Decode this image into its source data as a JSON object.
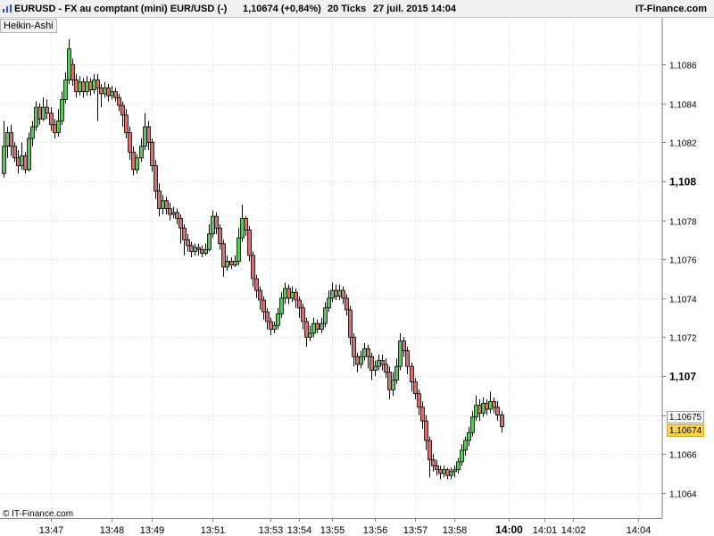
{
  "header": {
    "symbol": "EURUSD - FX au comptant (mini) EUR/USD (-)",
    "quote": "1,10674 (+0,84%)",
    "ticks": "20 Ticks",
    "date": "27 juil. 2015 14:04",
    "brand": "IT-Finance.com",
    "logo_icon": "chart-logo-icon"
  },
  "indicator_label": "Heikin-Ashi",
  "copyright": "© IT-Finance.com",
  "price_labels": {
    "cursor": "1,10675",
    "last": "1,10674"
  },
  "colors": {
    "up": "#5cc85c",
    "down": "#d97070",
    "last_price_bg": "#ffd24a",
    "grid": "#d9d9d9"
  },
  "chart_data": {
    "type": "candlestick",
    "style": "Heikin-Ashi",
    "ylim": [
      1.10628,
      1.10883
    ],
    "y_ticks": [
      {
        "v": 1.1064,
        "label": "1,1064",
        "bold": false
      },
      {
        "v": 1.1066,
        "label": "1,1066",
        "bold": false
      },
      {
        "v": 1.1068,
        "label": "1,1068",
        "bold": false
      },
      {
        "v": 1.107,
        "label": "1,107",
        "bold": true
      },
      {
        "v": 1.1072,
        "label": "1,1072",
        "bold": false
      },
      {
        "v": 1.1074,
        "label": "1,1074",
        "bold": false
      },
      {
        "v": 1.1076,
        "label": "1,1076",
        "bold": false
      },
      {
        "v": 1.1078,
        "label": "1,1078",
        "bold": false
      },
      {
        "v": 1.108,
        "label": "1,108",
        "bold": true
      },
      {
        "v": 1.1082,
        "label": "1,1082",
        "bold": false
      },
      {
        "v": 1.1084,
        "label": "1,1084",
        "bold": false
      },
      {
        "v": 1.1086,
        "label": "1,1086",
        "bold": false
      }
    ],
    "x_ticks": [
      {
        "i": 13,
        "label": "13:47",
        "bold": false
      },
      {
        "i": 30,
        "label": "13:48",
        "bold": false
      },
      {
        "i": 41,
        "label": "13:49",
        "bold": false
      },
      {
        "i": 58,
        "label": "13:51",
        "bold": false
      },
      {
        "i": 74,
        "label": "13:53",
        "bold": false
      },
      {
        "i": 82,
        "label": "13:54",
        "bold": false
      },
      {
        "i": 91,
        "label": "13:55",
        "bold": false
      },
      {
        "i": 103,
        "label": "13:56",
        "bold": false
      },
      {
        "i": 114,
        "label": "13:57",
        "bold": false
      },
      {
        "i": 125,
        "label": "13:58",
        "bold": false
      },
      {
        "i": 140,
        "label": "14:00",
        "bold": true
      },
      {
        "i": 150,
        "label": "14:01",
        "bold": false
      },
      {
        "i": 158,
        "label": "14:02",
        "bold": false
      },
      {
        "i": 176,
        "label": "14:04",
        "bold": false
      }
    ],
    "candles": [
      [
        1.10804,
        1.10818,
        1.10831,
        1.10802
      ],
      [
        1.10818,
        1.10825,
        1.10828,
        1.10812
      ],
      [
        1.10825,
        1.10818,
        1.10829,
        1.10813
      ],
      [
        1.10818,
        1.10812,
        1.1082,
        1.1081
      ],
      [
        1.10812,
        1.10808,
        1.10816,
        1.10804
      ],
      [
        1.10808,
        1.10813,
        1.1082,
        1.10806
      ],
      [
        1.10813,
        1.10806,
        1.10815,
        1.10804
      ],
      [
        1.10806,
        1.10822,
        1.10825,
        1.10805
      ],
      [
        1.10822,
        1.10828,
        1.10831,
        1.10818
      ],
      [
        1.10828,
        1.10838,
        1.10841,
        1.10826
      ],
      [
        1.10838,
        1.10832,
        1.1084,
        1.10829
      ],
      [
        1.10832,
        1.10838,
        1.10843,
        1.10831
      ],
      [
        1.10838,
        1.10835,
        1.10842,
        1.10832
      ],
      [
        1.10835,
        1.10829,
        1.10838,
        1.10826
      ],
      [
        1.10829,
        1.10825,
        1.10832,
        1.10822
      ],
      [
        1.10825,
        1.10831,
        1.10837,
        1.10823
      ],
      [
        1.10831,
        1.10842,
        1.10846,
        1.10829
      ],
      [
        1.10842,
        1.10852,
        1.10856,
        1.1084
      ],
      [
        1.10852,
        1.10868,
        1.10873,
        1.1085
      ],
      [
        1.1086,
        1.10852,
        1.10863,
        1.10849
      ],
      [
        1.10852,
        1.10846,
        1.10855,
        1.10843
      ],
      [
        1.10846,
        1.10851,
        1.10854,
        1.10844
      ],
      [
        1.10851,
        1.10846,
        1.10853,
        1.10843
      ],
      [
        1.10846,
        1.10851,
        1.10854,
        1.10844
      ],
      [
        1.10851,
        1.10847,
        1.10853,
        1.10844
      ],
      [
        1.10847,
        1.10852,
        1.10855,
        1.10845
      ],
      [
        1.10852,
        1.10848,
        1.10855,
        1.10831
      ],
      [
        1.10848,
        1.10845,
        1.1085,
        1.10838
      ],
      [
        1.10845,
        1.10848,
        1.10851,
        1.10843
      ],
      [
        1.10848,
        1.10844,
        1.1085,
        1.10841
      ],
      [
        1.10844,
        1.10846,
        1.10849,
        1.10842
      ],
      [
        1.10846,
        1.10843,
        1.10848,
        1.10841
      ],
      [
        1.10843,
        1.10839,
        1.10845,
        1.10836
      ],
      [
        1.10839,
        1.10834,
        1.10841,
        1.10828
      ],
      [
        1.10834,
        1.10825,
        1.10837,
        1.10822
      ],
      [
        1.10825,
        1.10815,
        1.10828,
        1.10811
      ],
      [
        1.10815,
        1.10806,
        1.10818,
        1.10803
      ],
      [
        1.10806,
        1.10812,
        1.10814,
        1.10804
      ],
      [
        1.10812,
        1.10818,
        1.10822,
        1.1081
      ],
      [
        1.10818,
        1.10828,
        1.10835,
        1.10816
      ],
      [
        1.10828,
        1.1082,
        1.10831,
        1.10816
      ],
      [
        1.1082,
        1.10808,
        1.10822,
        1.10805
      ],
      [
        1.10808,
        1.10795,
        1.10811,
        1.10791
      ],
      [
        1.10795,
        1.10786,
        1.10799,
        1.10782
      ],
      [
        1.10786,
        1.1079,
        1.10793,
        1.10783
      ],
      [
        1.1079,
        1.10786,
        1.10792,
        1.10783
      ],
      [
        1.10786,
        1.10783,
        1.10789,
        1.1078
      ],
      [
        1.10783,
        1.10784,
        1.10787,
        1.10781
      ],
      [
        1.10784,
        1.10781,
        1.10786,
        1.10778
      ],
      [
        1.10781,
        1.10776,
        1.10783,
        1.10768
      ],
      [
        1.10776,
        1.1077,
        1.10778,
        1.10762
      ],
      [
        1.1077,
        1.10767,
        1.10773,
        1.10764
      ],
      [
        1.10767,
        1.10764,
        1.10769,
        1.10761
      ],
      [
        1.10764,
        1.10766,
        1.10768,
        1.10762
      ],
      [
        1.10766,
        1.10765,
        1.10768,
        1.10762
      ],
      [
        1.10765,
        1.10763,
        1.10767,
        1.10761
      ],
      [
        1.10763,
        1.10765,
        1.10768,
        1.10762
      ],
      [
        1.10765,
        1.10773,
        1.10778,
        1.10764
      ],
      [
        1.10773,
        1.10782,
        1.10785,
        1.10771
      ],
      [
        1.10782,
        1.10776,
        1.10784,
        1.10773
      ],
      [
        1.10776,
        1.10768,
        1.10778,
        1.10765
      ],
      [
        1.10768,
        1.10756,
        1.1077,
        1.10751
      ],
      [
        1.10756,
        1.10759,
        1.10762,
        1.10754
      ],
      [
        1.10759,
        1.10757,
        1.10761,
        1.10755
      ],
      [
        1.10757,
        1.10759,
        1.10762,
        1.10756
      ],
      [
        1.10759,
        1.10771,
        1.10776,
        1.10757
      ],
      [
        1.10771,
        1.10781,
        1.10788,
        1.10769
      ],
      [
        1.10781,
        1.10775,
        1.10782,
        1.10772
      ],
      [
        1.10775,
        1.10762,
        1.10777,
        1.10759
      ],
      [
        1.10762,
        1.1075,
        1.10764,
        1.10746
      ],
      [
        1.1075,
        1.10744,
        1.10752,
        1.1074
      ],
      [
        1.10744,
        1.10739,
        1.10746,
        1.10734
      ],
      [
        1.10739,
        1.10733,
        1.10741,
        1.10729
      ],
      [
        1.10733,
        1.10728,
        1.10735,
        1.10724
      ],
      [
        1.10728,
        1.10724,
        1.1073,
        1.10721
      ],
      [
        1.10724,
        1.10726,
        1.10728,
        1.10722
      ],
      [
        1.10726,
        1.10732,
        1.10735,
        1.10724
      ],
      [
        1.10732,
        1.1074,
        1.10743,
        1.1073
      ],
      [
        1.1074,
        1.10745,
        1.10748,
        1.10737
      ],
      [
        1.10745,
        1.1074,
        1.10747,
        1.10737
      ],
      [
        1.1074,
        1.10743,
        1.10746,
        1.10738
      ],
      [
        1.10743,
        1.10739,
        1.10745,
        1.10735
      ],
      [
        1.10739,
        1.10735,
        1.10741,
        1.1073
      ],
      [
        1.10735,
        1.10728,
        1.10737,
        1.10724
      ],
      [
        1.10728,
        1.1072,
        1.1073,
        1.10715
      ],
      [
        1.1072,
        1.10722,
        1.10726,
        1.10718
      ],
      [
        1.10722,
        1.10727,
        1.1073,
        1.1072
      ],
      [
        1.10727,
        1.10724,
        1.10729,
        1.10722
      ],
      [
        1.10724,
        1.10727,
        1.1073,
        1.10722
      ],
      [
        1.10727,
        1.10735,
        1.10738,
        1.10725
      ],
      [
        1.10735,
        1.1074,
        1.10744,
        1.10733
      ],
      [
        1.1074,
        1.10744,
        1.10748,
        1.10738
      ],
      [
        1.10744,
        1.10741,
        1.10747,
        1.10739
      ],
      [
        1.10741,
        1.10744,
        1.10747,
        1.10739
      ],
      [
        1.10744,
        1.1074,
        1.10746,
        1.10737
      ],
      [
        1.1074,
        1.10734,
        1.10742,
        1.10731
      ],
      [
        1.10734,
        1.1072,
        1.10736,
        1.10716
      ],
      [
        1.1072,
        1.1071,
        1.10722,
        1.10705
      ],
      [
        1.1071,
        1.10706,
        1.10712,
        1.10702
      ],
      [
        1.10706,
        1.1071,
        1.10713,
        1.10704
      ],
      [
        1.1071,
        1.10714,
        1.10717,
        1.10708
      ],
      [
        1.10714,
        1.1071,
        1.10716,
        1.10704
      ],
      [
        1.1071,
        1.10703,
        1.10712,
        1.10698
      ],
      [
        1.10703,
        1.10705,
        1.10708,
        1.107
      ],
      [
        1.10705,
        1.10708,
        1.10711,
        1.10703
      ],
      [
        1.10708,
        1.10706,
        1.10711,
        1.10703
      ],
      [
        1.10706,
        1.10702,
        1.10709,
        1.10699
      ],
      [
        1.10702,
        1.10693,
        1.10705,
        1.10688
      ],
      [
        1.10693,
        1.10698,
        1.10702,
        1.1069
      ],
      [
        1.10698,
        1.10705,
        1.10709,
        1.10696
      ],
      [
        1.10705,
        1.10718,
        1.10722,
        1.10703
      ],
      [
        1.10718,
        1.10713,
        1.1072,
        1.1071
      ],
      [
        1.10713,
        1.10705,
        1.10715,
        1.10701
      ],
      [
        1.10705,
        1.10697,
        1.10707,
        1.10692
      ],
      [
        1.10697,
        1.10691,
        1.10699,
        1.10688
      ],
      [
        1.10691,
        1.10684,
        1.10693,
        1.1068
      ],
      [
        1.10684,
        1.10677,
        1.10687,
        1.10673
      ],
      [
        1.10677,
        1.10667,
        1.1068,
        1.10662
      ],
      [
        1.10667,
        1.10657,
        1.10669,
        1.10648
      ],
      [
        1.10657,
        1.10654,
        1.1066,
        1.10651
      ],
      [
        1.10654,
        1.10652,
        1.10657,
        1.10649
      ],
      [
        1.10652,
        1.1065,
        1.10654,
        1.10647
      ],
      [
        1.1065,
        1.10652,
        1.10654,
        1.10648
      ],
      [
        1.10652,
        1.10649,
        1.10653,
        1.10647
      ],
      [
        1.10649,
        1.10651,
        1.10653,
        1.10647
      ],
      [
        1.10651,
        1.10652,
        1.10654,
        1.10648
      ],
      [
        1.10652,
        1.10656,
        1.10658,
        1.1065
      ],
      [
        1.10656,
        1.10662,
        1.10665,
        1.10654
      ],
      [
        1.10662,
        1.10667,
        1.10669,
        1.10659
      ],
      [
        1.10667,
        1.10671,
        1.10674,
        1.10664
      ],
      [
        1.10671,
        1.10679,
        1.10682,
        1.10669
      ],
      [
        1.10679,
        1.10685,
        1.1069,
        1.10677
      ],
      [
        1.10685,
        1.10681,
        1.10688,
        1.10677
      ],
      [
        1.10681,
        1.10686,
        1.10689,
        1.10679
      ],
      [
        1.10686,
        1.10683,
        1.10688,
        1.1068
      ],
      [
        1.10683,
        1.10687,
        1.10692,
        1.10681
      ],
      [
        1.10687,
        1.10684,
        1.10689,
        1.10681
      ],
      [
        1.10684,
        1.1068,
        1.10687,
        1.10677
      ],
      [
        1.1068,
        1.10674,
        1.10682,
        1.10671
      ]
    ]
  }
}
